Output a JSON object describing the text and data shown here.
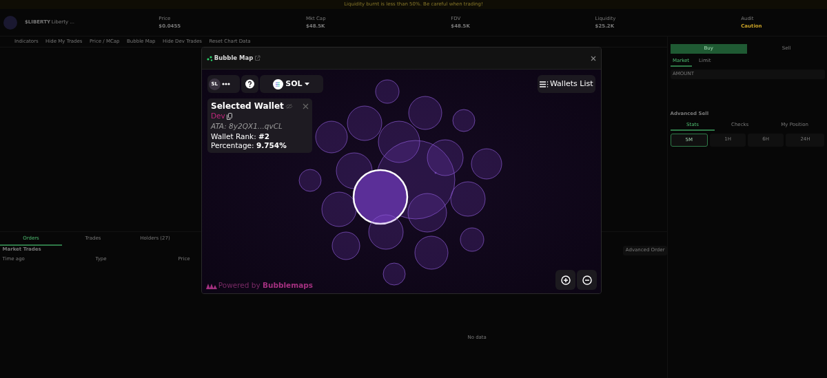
{
  "banner": {
    "text": "Liquidity burnt is less than 50%. Be careful when trading!"
  },
  "token": {
    "symbol": "$LIBERTY",
    "name": "Liberty ..."
  },
  "stats": [
    {
      "label": "Price",
      "value": "$0.0455"
    },
    {
      "label": "Mkt Cap",
      "value": "$48.5K"
    },
    {
      "label": "FDV",
      "value": "$48.5K"
    },
    {
      "label": "Liquidity",
      "value": "$25.2K"
    },
    {
      "label": "Audit",
      "value": "Caution"
    }
  ],
  "chart_toolbar": [
    "Indicators",
    "Hide My Trades",
    "Price / MCap",
    "Bubble Map",
    "Hide Dev Trades",
    "Reset Chart Data"
  ],
  "bottom_tabs": [
    {
      "label": "Orders",
      "selected": true
    },
    {
      "label": "Trades",
      "selected": false
    },
    {
      "label": "Holders (27)",
      "selected": false
    }
  ],
  "market_trades": {
    "title": "Market Trades",
    "columns": [
      "Time ago",
      "Type",
      "Price"
    ]
  },
  "empty_state": "No data",
  "advanced_order": "Advanced Order",
  "trade_panel": {
    "sides": [
      {
        "label": "Buy",
        "selected": true
      },
      {
        "label": "Sell",
        "selected": false
      }
    ],
    "order_types": [
      {
        "label": "Market",
        "selected": true
      },
      {
        "label": "Limit",
        "selected": false
      }
    ],
    "amount_label": "AMOUNT",
    "advanced_sell": "Advanced Sell",
    "info_tabs": [
      {
        "label": "Stats",
        "selected": true
      },
      {
        "label": "Checks",
        "selected": false
      },
      {
        "label": "My Position",
        "selected": false
      }
    ],
    "periods": [
      {
        "label": "5M",
        "selected": true
      },
      {
        "label": "1H",
        "selected": false
      },
      {
        "label": "6H",
        "selected": false
      },
      {
        "label": "24H",
        "selected": false
      }
    ]
  },
  "modal": {
    "title": "Bubble Map",
    "token_badge": "SL",
    "currency": "SOL",
    "wallets_button": "Wallets List",
    "selected_wallet": {
      "title": "Selected Wallet",
      "tag": "Dev",
      "ata": "ATA: 8y2QX1...qvCL",
      "rank": "Wallet Rank: **#2**",
      "percentage": "Percentage: **9.754%**"
    },
    "bubbles": [
      {
        "selected": false
      },
      {
        "selected": false
      },
      {
        "selected": false
      },
      {
        "selected": false
      },
      {
        "selected": false
      },
      {
        "selected": false
      },
      {
        "selected": false
      },
      {
        "selected": false
      },
      {
        "selected": false
      },
      {
        "selected": false
      },
      {
        "selected": false
      },
      {
        "selected": false
      },
      {
        "selected": true
      },
      {
        "selected": false
      },
      {
        "selected": false
      },
      {
        "selected": false
      },
      {
        "selected": false
      },
      {
        "selected": false
      },
      {
        "selected": false
      },
      {
        "selected": false
      },
      {
        "selected": false
      }
    ],
    "footer": "Powered by **Bubblemaps**"
  }
}
